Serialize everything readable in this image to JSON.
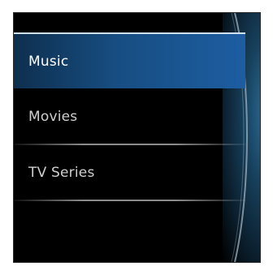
{
  "menu": {
    "items": [
      {
        "label": "Music",
        "active": true
      },
      {
        "label": "Movies",
        "active": false
      },
      {
        "label": "TV Series",
        "active": false
      }
    ]
  },
  "colors": {
    "accent": "#1d5da1",
    "background": "#000000",
    "text": "#cfcfcf",
    "active_text": "#ffffff"
  }
}
